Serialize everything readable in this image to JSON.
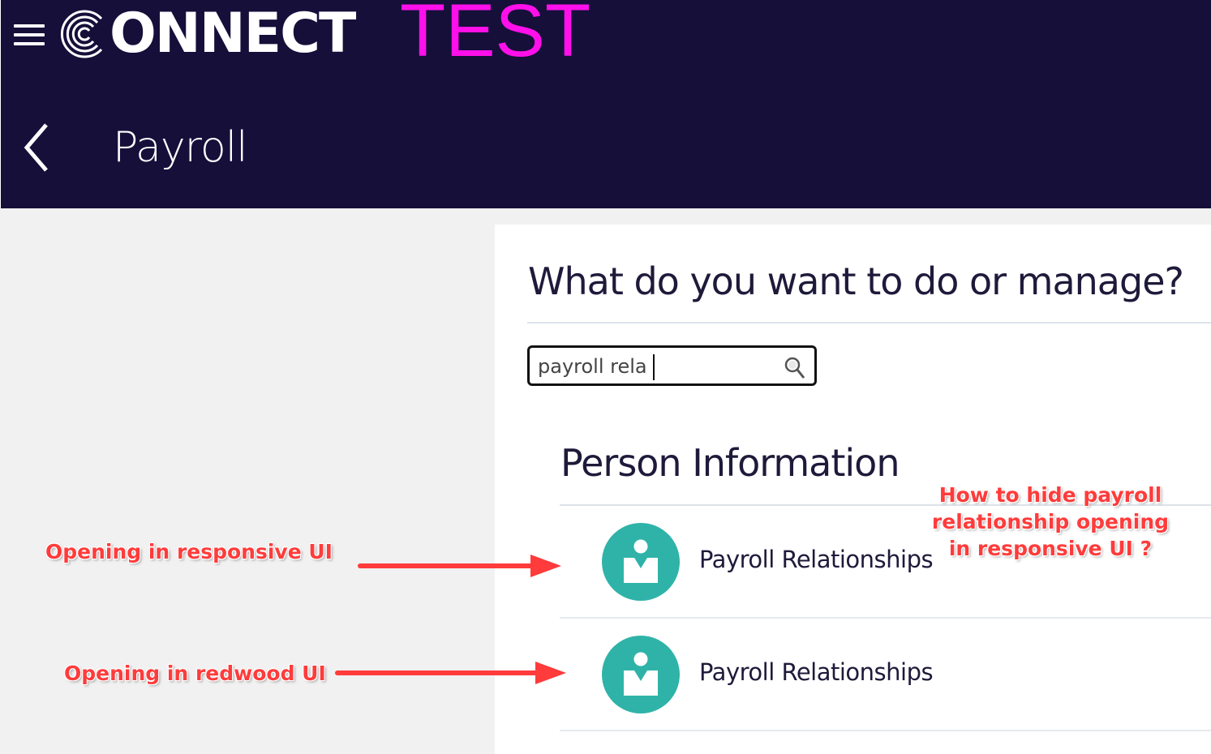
{
  "header": {
    "brand_text": "ONNECT",
    "env_label": "TEST",
    "page_title": "Payroll",
    "colors": {
      "background": "#150f3a",
      "env_label": "#ff10ea"
    },
    "icons": {
      "menu": "hamburger-menu-icon",
      "back": "chevron-left-icon",
      "logo": "connect-logo-c"
    }
  },
  "main": {
    "question": "What do you want to do or manage?",
    "search": {
      "value": "payroll rela",
      "icon": "search-icon"
    },
    "section_heading": "Person Information",
    "results": [
      {
        "label": "Payroll Relationships",
        "icon": "person-badge-icon"
      },
      {
        "label": "Payroll Relationships",
        "icon": "person-badge-icon"
      }
    ],
    "colors": {
      "result_icon": "#2fb3a9"
    }
  },
  "annotations": {
    "left_1": "Opening in responsive UI",
    "left_2": "Opening in redwood UI",
    "right": "How to hide payroll relationship opening in responsive UI ?",
    "color": "#ff3b3b"
  }
}
